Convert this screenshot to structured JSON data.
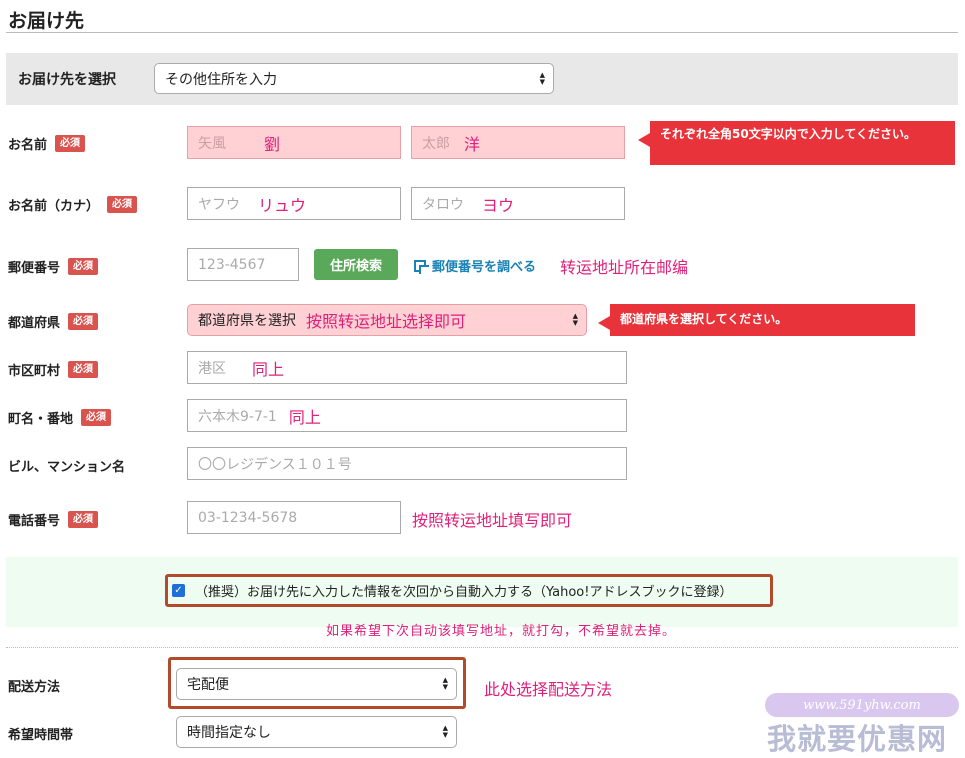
{
  "page_title": "お届け先",
  "address_select": {
    "label": "お届け先を選択",
    "value": "その他住所を入力"
  },
  "required_badge": "必須",
  "name": {
    "label": "お名前",
    "last": {
      "placeholder": "矢風",
      "annotation": "劉"
    },
    "first": {
      "placeholder": "太郎",
      "annotation": "洋"
    },
    "tooltip": "それぞれ全角50文字以内で入力してください。"
  },
  "kana": {
    "label": "お名前（カナ）",
    "last": {
      "placeholder": "ヤフウ",
      "annotation": "リュウ"
    },
    "first": {
      "placeholder": "タロウ",
      "annotation": "ヨウ"
    }
  },
  "zip": {
    "label": "郵便番号",
    "placeholder": "123-4567",
    "search_button": "住所検索",
    "lookup_link": "郵便番号を調べる",
    "annotation": "转运地址所在邮编"
  },
  "prefecture": {
    "label": "都道府県",
    "value": "都道府県を選択",
    "annotation": "按照转运地址选择即可",
    "tooltip": "都道府県を選択してください。"
  },
  "city": {
    "label": "市区町村",
    "placeholder": "港区",
    "annotation": "同上"
  },
  "street": {
    "label": "町名・番地",
    "placeholder": "六本木9-7-1",
    "annotation": "同上"
  },
  "building": {
    "label": "ビル、マンション名",
    "placeholder": "〇〇レジデンス１０１号"
  },
  "phone": {
    "label": "電話番号",
    "placeholder": "03-1234-5678",
    "annotation": "按照转运地址填写即可"
  },
  "save_option": {
    "checked": true,
    "label": "（推奨）お届け先に入力した情報を次回から自動入力する（Yahoo!アドレスブックに登録）",
    "annotation": "如果希望下次自动该填写地址，就打勾，不希望就去掉。"
  },
  "shipping": {
    "label": "配送方法",
    "value": "宅配便",
    "annotation": "此处选择配送方法"
  },
  "delivery_time": {
    "label": "希望時間帯",
    "value": "時間指定なし"
  },
  "watermark": {
    "url": "www.591yhw.com",
    "name": "我就要优惠网"
  },
  "colors": {
    "required": "#d9534f",
    "tooltip": "#e8333a",
    "annotation": "#e0207a",
    "search_button": "#5aa85a",
    "link": "#1a82b5"
  }
}
